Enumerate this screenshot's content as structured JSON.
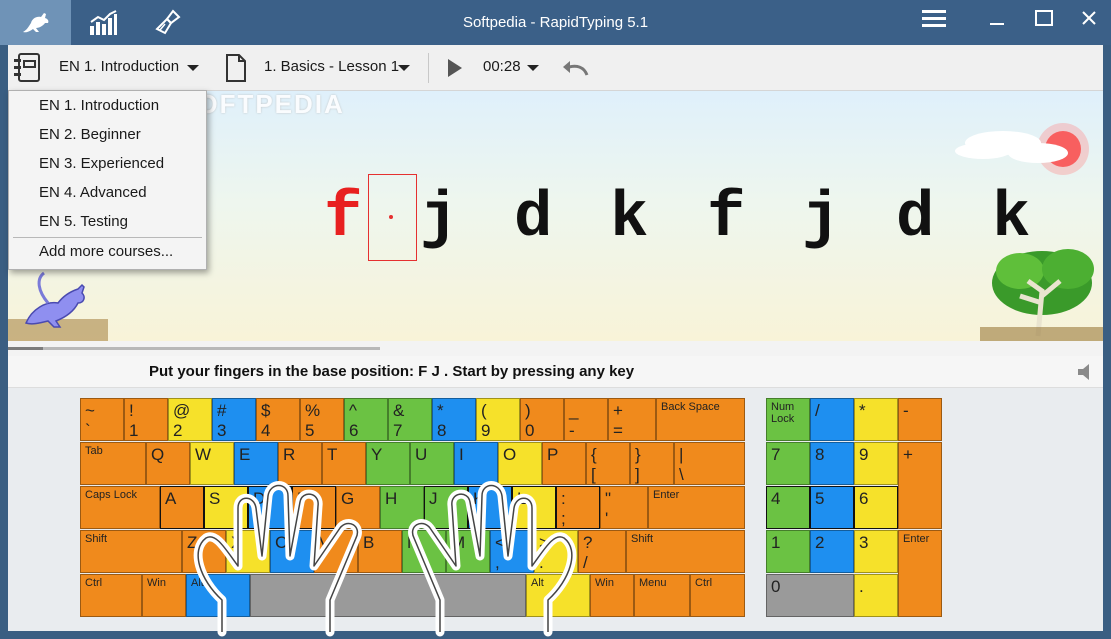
{
  "window": {
    "title": "Softpedia - RapidTyping  5.1"
  },
  "titlebar": {
    "tabs": [
      {
        "name": "typing-tab",
        "icon": "kangaroo-icon"
      },
      {
        "name": "statistics-tab",
        "icon": "bar-chart-icon"
      },
      {
        "name": "editor-tab",
        "icon": "broom-icon"
      }
    ],
    "buttons": [
      "menu-icon",
      "minimize-icon",
      "maximize-icon",
      "close-icon"
    ]
  },
  "toolbar": {
    "course": "EN 1. Introduction",
    "lesson": "1. Basics - Lesson 1",
    "time": "00:28"
  },
  "course_menu": {
    "items": [
      "EN 1. Introduction",
      "EN 2. Beginner",
      "EN 3. Experienced",
      "EN 4. Advanced",
      "EN 5. Testing"
    ],
    "footer": "Add more courses..."
  },
  "lesson": {
    "typed": "f",
    "chars": [
      "j",
      "d",
      "k",
      "f",
      "j",
      "d",
      "k"
    ],
    "typed_color": "#e82020",
    "watermark": "SOFTPEDIA",
    "instruction": "Put your fingers in the base position:  F  J .  Start by pressing any key"
  },
  "keyboard": {
    "row1": [
      [
        "~",
        "`"
      ],
      [
        "!",
        "1"
      ],
      [
        "@",
        "2"
      ],
      [
        "#",
        "3"
      ],
      [
        "$",
        "4"
      ],
      [
        "%",
        "5"
      ],
      [
        "^",
        "6"
      ],
      [
        "&",
        "7"
      ],
      [
        "*",
        "8"
      ],
      [
        "(",
        "9"
      ],
      [
        ")",
        "0"
      ],
      [
        "_",
        "-"
      ],
      [
        "+",
        "="
      ],
      [
        "Back Space",
        ""
      ]
    ],
    "row2": [
      [
        "Tab",
        ""
      ],
      [
        "Q",
        ""
      ],
      [
        "W",
        ""
      ],
      [
        "E",
        ""
      ],
      [
        "R",
        ""
      ],
      [
        "T",
        ""
      ],
      [
        "Y",
        ""
      ],
      [
        "U",
        ""
      ],
      [
        "I",
        ""
      ],
      [
        "O",
        ""
      ],
      [
        "P",
        ""
      ],
      [
        "{",
        "["
      ],
      [
        "}",
        "]"
      ],
      [
        "|",
        "\\"
      ]
    ],
    "row3": [
      [
        "Caps Lock",
        ""
      ],
      [
        "A",
        ""
      ],
      [
        "S",
        ""
      ],
      [
        "D",
        ""
      ],
      [
        "F",
        ""
      ],
      [
        "G",
        ""
      ],
      [
        "H",
        ""
      ],
      [
        "J",
        ""
      ],
      [
        "K",
        ""
      ],
      [
        "L",
        ""
      ],
      [
        ":",
        ";"
      ],
      [
        "\"",
        "'"
      ],
      [
        "Enter",
        ""
      ]
    ],
    "row4": [
      [
        "Shift",
        ""
      ],
      [
        "Z",
        ""
      ],
      [
        "X",
        ""
      ],
      [
        "C",
        ""
      ],
      [
        "V",
        ""
      ],
      [
        "B",
        ""
      ],
      [
        "N",
        ""
      ],
      [
        "M",
        ""
      ],
      [
        "<",
        ","
      ],
      [
        ">",
        "."
      ],
      [
        "?",
        "/"
      ],
      [
        "Shift",
        ""
      ]
    ],
    "row5": [
      [
        "Ctrl",
        ""
      ],
      [
        "Win",
        ""
      ],
      [
        "Alt",
        ""
      ],
      [
        "",
        ""
      ],
      [
        "Alt",
        ""
      ],
      [
        "Win",
        ""
      ],
      [
        "Menu",
        ""
      ],
      [
        "Ctrl",
        ""
      ]
    ],
    "numpad": [
      [
        "Num Lock",
        ""
      ],
      [
        "/",
        ""
      ],
      [
        "*",
        ""
      ],
      [
        "-",
        ""
      ],
      [
        "7",
        ""
      ],
      [
        "8",
        ""
      ],
      [
        "9",
        ""
      ],
      [
        "+",
        ""
      ],
      [
        "4",
        ""
      ],
      [
        "5",
        ""
      ],
      [
        "6",
        ""
      ],
      [
        "1",
        ""
      ],
      [
        "2",
        ""
      ],
      [
        "3",
        ""
      ],
      [
        "Enter",
        ""
      ],
      [
        "0",
        ""
      ],
      [
        ".",
        ""
      ]
    ]
  }
}
